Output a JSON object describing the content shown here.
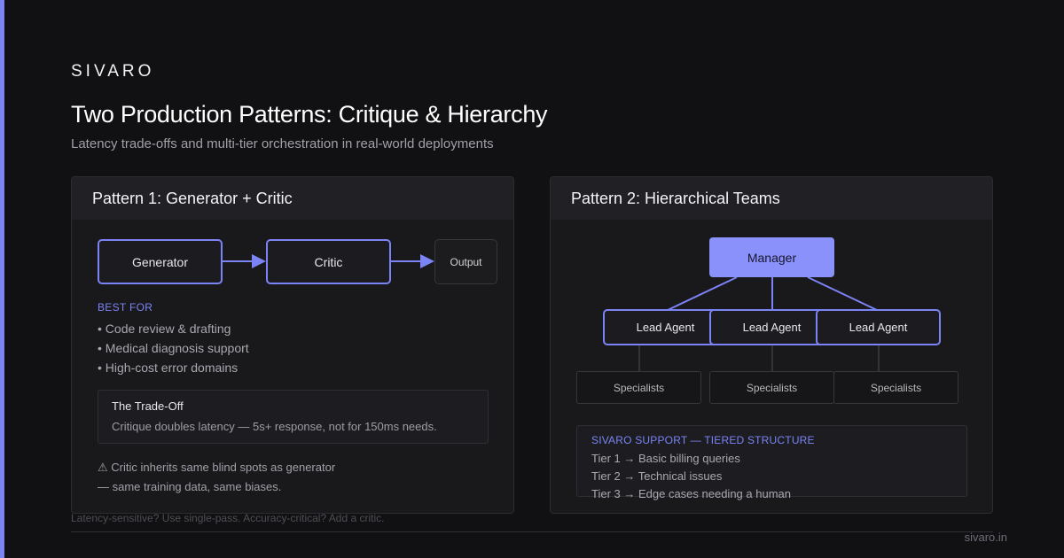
{
  "brand": "SIVARO",
  "title": "Two Production Patterns: Critique & Hierarchy",
  "subtitle": "Latency trade-offs and multi-tier orchestration in real-world deployments",
  "accent_color": "#7b83f5",
  "pattern1": {
    "heading": "Pattern 1: Generator + Critic",
    "flow": {
      "generator": "Generator",
      "critic": "Critic",
      "output": "Output"
    },
    "best_for_label": "BEST FOR",
    "best_for": [
      "• Code review & drafting",
      "• Medical diagnosis support",
      "• High-cost error domains"
    ],
    "tradeoff": {
      "title": "The Trade-Off",
      "text": "Critique doubles latency — 5s+ response, not for 150ms needs."
    },
    "warning": [
      "⚠ Critic inherits same blind spots as generator",
      "— same training data, same biases."
    ]
  },
  "pattern2": {
    "heading": "Pattern 2: Hierarchical Teams",
    "manager": "Manager",
    "leads": [
      "Lead Agent",
      "Lead Agent",
      "Lead Agent"
    ],
    "specialists": [
      "Specialists",
      "Specialists",
      "Specialists"
    ],
    "support": {
      "title": "SIVARO SUPPORT — TIERED STRUCTURE",
      "tiers": [
        "Tier 1 → Basic billing queries",
        "Tier 2 → Technical issues",
        "Tier 3 → Edge cases needing a human"
      ]
    }
  },
  "footer_note": "Latency-sensitive? Use single-pass. Accuracy-critical? Add a critic.",
  "site": "sivaro.in"
}
